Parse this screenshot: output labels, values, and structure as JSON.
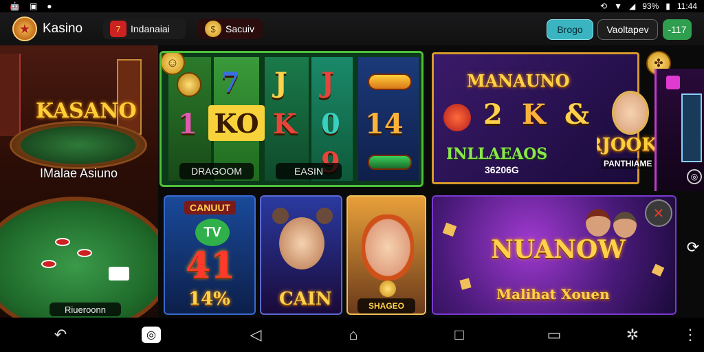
{
  "status_bar": {
    "battery": "93%",
    "time": "11:44"
  },
  "app_bar": {
    "title": "Kasino",
    "tab_1": "Indanaiai",
    "tab_2": "Sacuiv",
    "button_1": "Brogo",
    "button_2": "Vaoltapev",
    "button_3": "-117"
  },
  "left_panel": {
    "sign": "KASANO",
    "caption": "IMalae Asiuno",
    "table_label": "Riueroonn"
  },
  "slot_panel": {
    "symbols": [
      "7",
      "J",
      "J",
      "1",
      "KO",
      "K",
      "0",
      "14",
      "9"
    ],
    "label_1": "DRAGOOM",
    "label_2": "EASIN"
  },
  "promo_panel": {
    "title": "MANAUNO",
    "symbols": [
      "2",
      "K",
      "&"
    ],
    "subtitle": "INLLAEAOS",
    "code": "36206G",
    "brand": "RJOOK",
    "brand_sub": "PANTHIAME"
  },
  "cards": [
    {
      "top": "CANUUT",
      "big": "41",
      "bottom": "14%"
    },
    {
      "bottom": "CAIN"
    },
    {
      "bottom": "SHAGEO"
    }
  ],
  "banner": {
    "title": "NUANOW",
    "subtitle": "Malihat Xouen"
  },
  "colors": {
    "accent_teal": "#3bb4c1",
    "accent_green": "#2f9e4f",
    "gold": "#ffd24a"
  }
}
